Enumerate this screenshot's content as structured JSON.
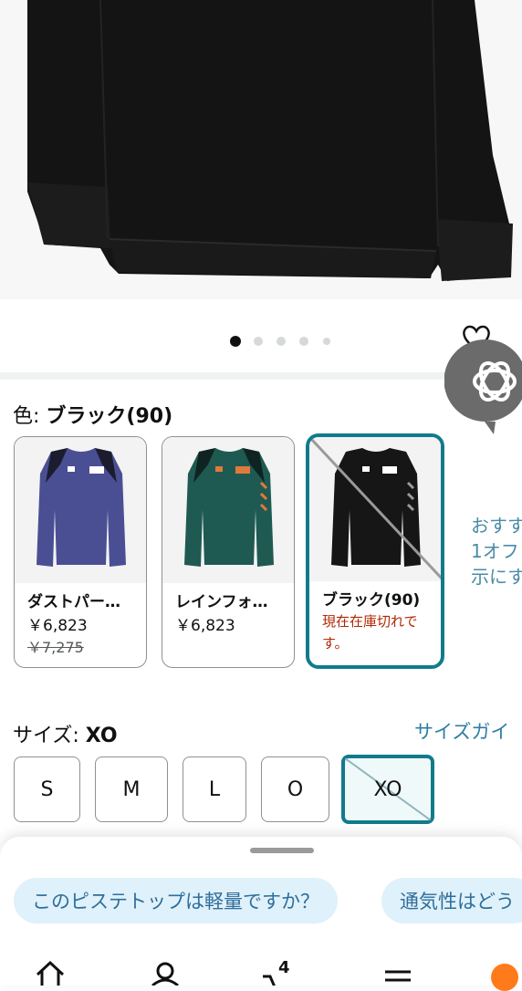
{
  "gallery": {
    "dot_count": 5,
    "active_index": 0
  },
  "color": {
    "label": "色: ",
    "selected": "ブラック(90)",
    "swatches": [
      {
        "name": "ダストパー…",
        "price": "￥6,823",
        "original_price": "￥7,275"
      },
      {
        "name": "レインフォ…",
        "price": "￥6,823"
      },
      {
        "name": "ブラック(90)",
        "status": "現在在庫切れです。"
      }
    ],
    "side_text": [
      "おすす",
      "1オフ",
      "示にす"
    ]
  },
  "size": {
    "label": "サイズ: ",
    "selected": "XO",
    "guide": "サイズガイ",
    "options": [
      "S",
      "M",
      "L",
      "O",
      "XO"
    ]
  },
  "questions": {
    "chips": [
      "このピステトップは軽量ですか？",
      "通気性はどう"
    ]
  },
  "nav": {
    "cart_count": "4"
  },
  "colors": {
    "accent": "#117b8b",
    "link": "#2f7ea6",
    "out_of_stock": "#b12704",
    "chip_bg": "#dff1fa"
  }
}
